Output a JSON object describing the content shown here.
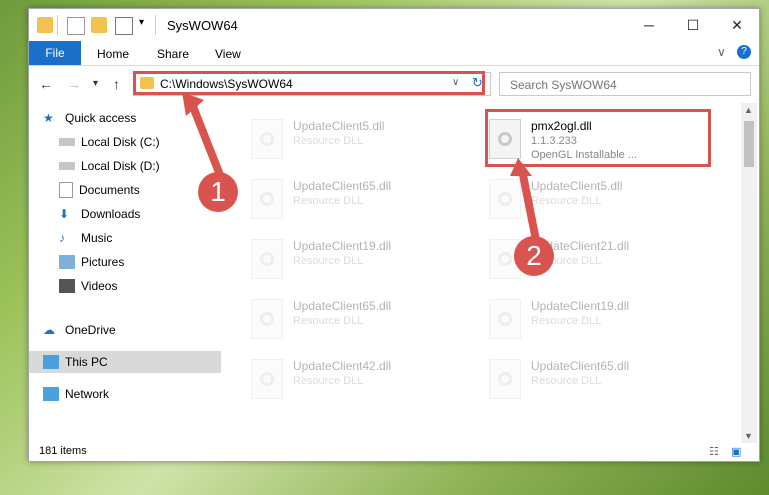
{
  "window": {
    "title": "SysWOW64"
  },
  "ribbon": {
    "tabs": [
      "File",
      "Home",
      "Share",
      "View"
    ]
  },
  "address": {
    "path": "C:\\Windows\\SysWOW64",
    "search_placeholder": "Search SysWOW64"
  },
  "nav": {
    "items": [
      {
        "label": "Quick access",
        "icon": "star-icon"
      },
      {
        "label": "Local Disk (C:)",
        "icon": "drive-icon"
      },
      {
        "label": "Local Disk (D:)",
        "icon": "drive-icon"
      },
      {
        "label": "Documents",
        "icon": "documents-icon"
      },
      {
        "label": "Downloads",
        "icon": "download-icon"
      },
      {
        "label": "Music",
        "icon": "music-icon"
      },
      {
        "label": "Pictures",
        "icon": "pictures-icon"
      },
      {
        "label": "Videos",
        "icon": "videos-icon"
      },
      {
        "label": "OneDrive",
        "icon": "cloud-icon"
      },
      {
        "label": "This PC",
        "icon": "pc-icon"
      },
      {
        "label": "Network",
        "icon": "network-icon"
      }
    ]
  },
  "files": {
    "highlight": {
      "name": "pmx2ogl.dll",
      "version": "1.1.3.233",
      "desc": "OpenGL Installable ..."
    },
    "left": [
      {
        "name": "UpdateClient5.dll",
        "desc": "Resource DLL"
      },
      {
        "name": "UpdateClient65.dll",
        "desc": "Resource DLL"
      },
      {
        "name": "UpdateClient19.dll",
        "desc": "Resource DLL"
      },
      {
        "name": "UpdateClient65.dll",
        "desc": "Resource DLL"
      },
      {
        "name": "UpdateClient42.dll",
        "desc": "Resource DLL"
      }
    ],
    "right": [
      {
        "name": "UpdateClient5.dll",
        "desc": "Resource DLL"
      },
      {
        "name": "UpdateClient21.dll",
        "desc": "Resource DLL"
      },
      {
        "name": "UpdateClient19.dll",
        "desc": "Resource DLL"
      },
      {
        "name": "UpdateClient65.dll",
        "desc": "Resource DLL"
      }
    ]
  },
  "status": {
    "count": "181 items"
  },
  "annotations": {
    "badge1": "1",
    "badge2": "2"
  }
}
